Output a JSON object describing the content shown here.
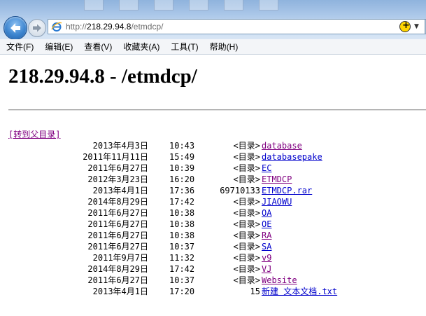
{
  "browser": {
    "url_scheme": "http://",
    "url_host": "218.29.94.8",
    "url_path": "/etmdcp/",
    "menu": [
      "文件(F)",
      "编辑(E)",
      "查看(V)",
      "收藏夹(A)",
      "工具(T)",
      "帮助(H)"
    ],
    "accent": "#3d85cf",
    "addon_glyph": "+",
    "close_glyph": "✕"
  },
  "page": {
    "title": "218.29.94.8 - /etmdcp/",
    "parent_link": "[转到父目录]",
    "entries": [
      {
        "date": "2013年4月3日",
        "time": "10:43",
        "size": "<目录>",
        "name": "database",
        "visited": true
      },
      {
        "date": "2011年11月11日",
        "time": "15:49",
        "size": "<目录>",
        "name": "databasepake",
        "visited": false
      },
      {
        "date": "2011年6月27日",
        "time": "10:39",
        "size": "<目录>",
        "name": "EC",
        "visited": false
      },
      {
        "date": "2012年3月23日",
        "time": "16:20",
        "size": "<目录>",
        "name": "ETMDCP",
        "visited": true
      },
      {
        "date": "2013年4月1日",
        "time": "17:36",
        "size": "69710133",
        "name": "ETMDCP.rar",
        "visited": false
      },
      {
        "date": "2014年8月29日",
        "time": "17:42",
        "size": "<目录>",
        "name": "JIAOWU",
        "visited": false
      },
      {
        "date": "2011年6月27日",
        "time": "10:38",
        "size": "<目录>",
        "name": "OA",
        "visited": false
      },
      {
        "date": "2011年6月27日",
        "time": "10:38",
        "size": "<目录>",
        "name": "OE",
        "visited": false
      },
      {
        "date": "2011年6月27日",
        "time": "10:38",
        "size": "<目录>",
        "name": "RA",
        "visited": true
      },
      {
        "date": "2011年6月27日",
        "time": "10:37",
        "size": "<目录>",
        "name": "SA",
        "visited": false
      },
      {
        "date": "2011年9月7日",
        "time": "11:32",
        "size": "<目录>",
        "name": "v9",
        "visited": true
      },
      {
        "date": "2014年8月29日",
        "time": "17:42",
        "size": "<目录>",
        "name": "VJ",
        "visited": true
      },
      {
        "date": "2011年6月27日",
        "time": "10:37",
        "size": "<目录>",
        "name": "Website",
        "visited": true
      },
      {
        "date": "2013年4月1日",
        "time": "17:20",
        "size": "15",
        "name": "新建 文本文档.txt",
        "visited": false
      }
    ],
    "colors": {
      "visited": "#800080",
      "unvisited": "#0000cc"
    }
  }
}
